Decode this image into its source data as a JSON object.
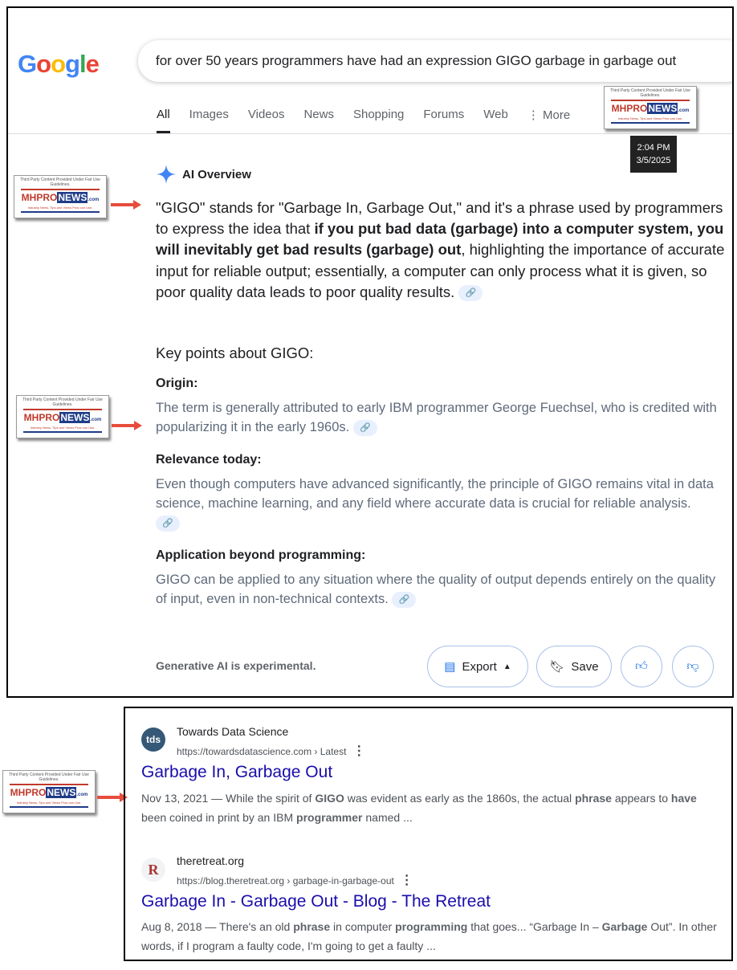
{
  "search": {
    "logo": "Google",
    "query": "for over 50 years programmers have had an expression GIGO garbage in garbage out"
  },
  "tabs": [
    {
      "label": "All"
    },
    {
      "label": "Images"
    },
    {
      "label": "Videos"
    },
    {
      "label": "News"
    },
    {
      "label": "Shopping"
    },
    {
      "label": "Forums"
    },
    {
      "label": "Web"
    },
    {
      "label": "More"
    }
  ],
  "tooltip": {
    "time": "2:04 PM",
    "date": "3/5/2025"
  },
  "watermark": {
    "caption": "Third Party Content Provided Under Fair Use Guidelines.",
    "brand_a": "MHPRO",
    "brand_b": "NEWS",
    "brand_c": ".com",
    "tagline": "Industry News, Tips and Views Pros can Use."
  },
  "ai_overview": {
    "label": "AI Overview",
    "intro_a": "\"GIGO\" stands for \"Garbage In, Garbage Out,\" and it's a phrase used by programmers to express the idea that ",
    "intro_bold": "if you put bad data (garbage) into a computer system, you will inevitably get bad results (garbage) out",
    "intro_b": ", highlighting the importance of accurate input for reliable output; essentially, a computer can only process what it is given, so poor quality data leads to poor quality results.",
    "key_heading": "Key points about GIGO:",
    "points": [
      {
        "title": "Origin:",
        "text": "The term is generally attributed to early IBM programmer George Fuechsel, who is credited with popularizing it in the early 1960s."
      },
      {
        "title": "Relevance today:",
        "text": "Even though computers have advanced significantly, the principle of GIGO remains vital in data science, machine learning, and any field where accurate data is crucial for reliable analysis."
      },
      {
        "title": "Application beyond programming:",
        "text": "GIGO can be applied to any situation where the quality of output depends entirely on the quality of input, even in non-technical contexts."
      }
    ],
    "footer": "Generative AI is experimental.",
    "export_label": "Export",
    "save_label": "Save"
  },
  "results": [
    {
      "favicon": "tds",
      "site": "Towards Data Science",
      "url": "https://towardsdatascience.com › Latest",
      "title": "Garbage In, Garbage Out",
      "snippet_html": "Nov 13, 2021 — While the spirit of <b>GIGO</b> was evident as early as the 1860s, the actual <b>phrase</b> appears to <b>have</b> been coined in print by an IBM <b>programmer</b> named ..."
    },
    {
      "favicon": "R",
      "site": "theretreat.org",
      "url": "https://blog.theretreat.org › garbage-in-garbage-out",
      "title": "Garbage In - Garbage Out - Blog - The Retreat",
      "snippet_html": "Aug 8, 2018 — There's an old <b>phrase</b> in computer <b>programming</b> that goes... “Garbage In – <b>Garbage</b> Out”. In other words, if I program a faulty code, I'm going to get a faulty ..."
    }
  ],
  "colors": {
    "link": "#1a0dab",
    "accent": "#4285f4"
  }
}
